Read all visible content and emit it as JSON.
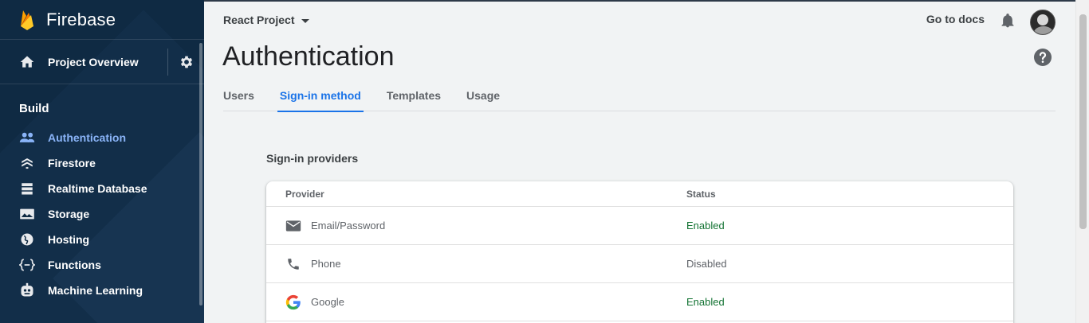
{
  "app": {
    "name": "Firebase"
  },
  "sidebar": {
    "overview_label": "Project Overview",
    "section_label": "Build",
    "items": [
      {
        "label": "Authentication",
        "icon": "people-icon",
        "active": true
      },
      {
        "label": "Firestore",
        "icon": "firestore-icon",
        "active": false
      },
      {
        "label": "Realtime Database",
        "icon": "database-icon",
        "active": false
      },
      {
        "label": "Storage",
        "icon": "storage-icon",
        "active": false
      },
      {
        "label": "Hosting",
        "icon": "hosting-icon",
        "active": false
      },
      {
        "label": "Functions",
        "icon": "functions-icon",
        "active": false
      },
      {
        "label": "Machine Learning",
        "icon": "robot-icon",
        "active": false
      }
    ]
  },
  "header": {
    "project": "React Project",
    "docs_label": "Go to docs",
    "title": "Authentication"
  },
  "tabs": [
    {
      "label": "Users",
      "active": false
    },
    {
      "label": "Sign-in method",
      "active": true
    },
    {
      "label": "Templates",
      "active": false
    },
    {
      "label": "Usage",
      "active": false
    }
  ],
  "providers": {
    "section_label": "Sign-in providers",
    "columns": [
      "Provider",
      "Status"
    ],
    "rows": [
      {
        "name": "Email/Password",
        "icon": "mail-icon",
        "status": "Enabled"
      },
      {
        "name": "Phone",
        "icon": "phone-icon",
        "status": "Disabled"
      },
      {
        "name": "Google",
        "icon": "google-icon",
        "status": "Enabled"
      }
    ]
  },
  "colors": {
    "sidebar_bg": "#0f2a43",
    "active_nav": "#8ab4f8",
    "accent": "#1a73e8",
    "enabled": "#137333"
  }
}
